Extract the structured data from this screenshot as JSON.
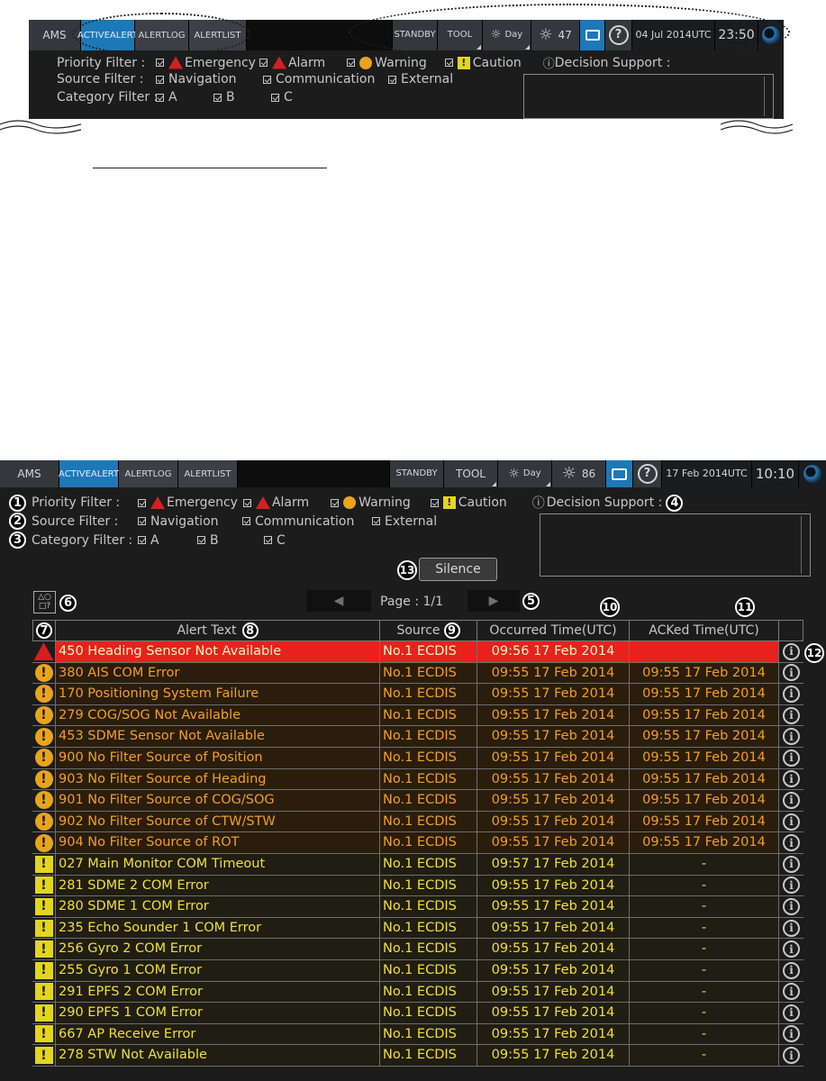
{
  "top": {
    "bar": {
      "ams": "AMS",
      "tab1": [
        "ACTIVE",
        "ALERT"
      ],
      "tab2": [
        "ALERT",
        "LOG"
      ],
      "tab3": [
        "ALERT",
        "LIST"
      ],
      "standby": "STANDBY",
      "tool": "TOOL",
      "day": "Day",
      "brightness": "47",
      "help": "?",
      "date": [
        "04 Jul 2014",
        "UTC"
      ],
      "time": "23:50"
    },
    "filters": {
      "priority_label": "Priority Filter :",
      "source_label": "Source Filter :",
      "category_label": "Category Filter :",
      "emergency": "Emergency",
      "alarm": "Alarm",
      "warning": "Warning",
      "caution": "Caution",
      "navigation": "Navigation",
      "communication": "Communication",
      "external": "External",
      "cat_a": "A",
      "cat_b": "B",
      "cat_c": "C",
      "decision_support": "Decision Support :"
    }
  },
  "main": {
    "bar": {
      "ams": "AMS",
      "tab1": [
        "ACTIVE",
        "ALERT"
      ],
      "tab2": [
        "ALERT",
        "LOG"
      ],
      "tab3": [
        "ALERT",
        "LIST"
      ],
      "standby": "STANDBY",
      "tool": "TOOL",
      "day": "Day",
      "brightness": "86",
      "help": "?",
      "date": [
        "17 Feb 2014",
        "UTC"
      ],
      "time": "10:10"
    },
    "filters": {
      "priority_label": "Priority Filter :",
      "source_label": "Source Filter :",
      "category_label": "Category Filter :",
      "emergency": "Emergency",
      "alarm": "Alarm",
      "warning": "Warning",
      "caution": "Caution",
      "navigation": "Navigation",
      "communication": "Communication",
      "external": "External",
      "cat_a": "A",
      "cat_b": "B",
      "cat_c": "C",
      "decision_support": "Decision Support :"
    },
    "silence": "Silence",
    "page": "Page : 1/1",
    "callouts": [
      "1",
      "2",
      "3",
      "4",
      "5",
      "6",
      "7",
      "8",
      "9",
      "10",
      "11",
      "12",
      "13"
    ],
    "table": {
      "headers": [
        "Alert Text",
        "Source",
        "Occurred Time(UTC)",
        "ACKed Time(UTC)"
      ],
      "rows": [
        {
          "type": "emergency",
          "text": "450 Heading Sensor Not Available",
          "source": "No.1 ECDIS",
          "occurred": "09:56 17 Feb 2014",
          "acked": ""
        },
        {
          "type": "warning",
          "text": "380 AIS COM Error",
          "source": "No.1 ECDIS",
          "occurred": "09:55 17 Feb 2014",
          "acked": "09:55 17 Feb 2014"
        },
        {
          "type": "warning",
          "text": "170 Positioning System Failure",
          "source": "No.1 ECDIS",
          "occurred": "09:55 17 Feb 2014",
          "acked": "09:55 17 Feb 2014"
        },
        {
          "type": "warning",
          "text": "279 COG/SOG Not Available",
          "source": "No.1 ECDIS",
          "occurred": "09:55 17 Feb 2014",
          "acked": "09:55 17 Feb 2014"
        },
        {
          "type": "warning",
          "text": "453 SDME Sensor Not Available",
          "source": "No.1 ECDIS",
          "occurred": "09:55 17 Feb 2014",
          "acked": "09:55 17 Feb 2014"
        },
        {
          "type": "warning",
          "text": "900 No Filter Source of Position",
          "source": "No.1 ECDIS",
          "occurred": "09:55 17 Feb 2014",
          "acked": "09:55 17 Feb 2014"
        },
        {
          "type": "warning",
          "text": "903 No Filter Source of Heading",
          "source": "No.1 ECDIS",
          "occurred": "09:55 17 Feb 2014",
          "acked": "09:55 17 Feb 2014"
        },
        {
          "type": "warning",
          "text": "901 No Filter Source of COG/SOG",
          "source": "No.1 ECDIS",
          "occurred": "09:55 17 Feb 2014",
          "acked": "09:55 17 Feb 2014"
        },
        {
          "type": "warning",
          "text": "902 No Filter Source of CTW/STW",
          "source": "No.1 ECDIS",
          "occurred": "09:55 17 Feb 2014",
          "acked": "09:55 17 Feb 2014"
        },
        {
          "type": "warning",
          "text": "904 No Filter Source of ROT",
          "source": "No.1 ECDIS",
          "occurred": "09:55 17 Feb 2014",
          "acked": "09:55 17 Feb 2014"
        },
        {
          "type": "caution",
          "text": "027 Main Monitor COM Timeout",
          "source": "No.1 ECDIS",
          "occurred": "09:57 17 Feb 2014",
          "acked": "-"
        },
        {
          "type": "caution",
          "text": "281 SDME 2 COM Error",
          "source": "No.1 ECDIS",
          "occurred": "09:55 17 Feb 2014",
          "acked": "-"
        },
        {
          "type": "caution",
          "text": "280 SDME 1 COM Error",
          "source": "No.1 ECDIS",
          "occurred": "09:55 17 Feb 2014",
          "acked": "-"
        },
        {
          "type": "caution",
          "text": "235 Echo Sounder 1 COM Error",
          "source": "No.1 ECDIS",
          "occurred": "09:55 17 Feb 2014",
          "acked": "-"
        },
        {
          "type": "caution",
          "text": "256 Gyro 2 COM Error",
          "source": "No.1 ECDIS",
          "occurred": "09:55 17 Feb 2014",
          "acked": "-"
        },
        {
          "type": "caution",
          "text": "255 Gyro 1 COM Error",
          "source": "No.1 ECDIS",
          "occurred": "09:55 17 Feb 2014",
          "acked": "-"
        },
        {
          "type": "caution",
          "text": "291 EPFS 2 COM Error",
          "source": "No.1 ECDIS",
          "occurred": "09:55 17 Feb 2014",
          "acked": "-"
        },
        {
          "type": "caution",
          "text": "290 EPFS 1 COM Error",
          "source": "No.1 ECDIS",
          "occurred": "09:55 17 Feb 2014",
          "acked": "-"
        },
        {
          "type": "caution",
          "text": "667 AP Receive Error",
          "source": "No.1 ECDIS",
          "occurred": "09:55 17 Feb 2014",
          "acked": "-"
        },
        {
          "type": "caution",
          "text": "278 STW Not Available",
          "source": "No.1 ECDIS",
          "occurred": "09:55 17 Feb 2014",
          "acked": "-"
        }
      ]
    }
  },
  "colors": {
    "emergency_row_bg": "#e8211c",
    "emergency_text": "#fff7c0",
    "warning_row_bg": "#2a1d0c",
    "warning_text": "#f0a020",
    "caution_row_bg": "#201d12",
    "caution_text": "#f0e030",
    "active_tab": "#1d78b8"
  }
}
